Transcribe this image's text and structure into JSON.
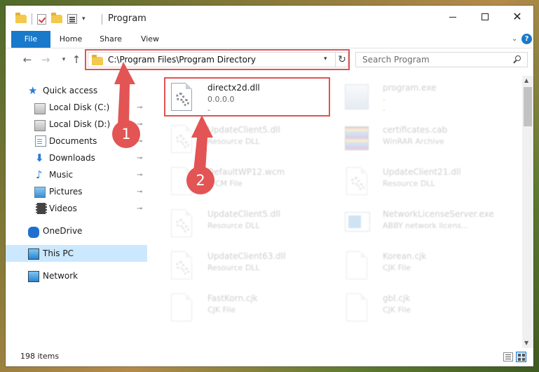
{
  "window": {
    "title": "Program",
    "controls": {
      "minimize": "—",
      "maximize": "☐",
      "close": "✕"
    }
  },
  "ribbon": {
    "tabs": [
      {
        "label": "File",
        "active": true
      },
      {
        "label": "Home"
      },
      {
        "label": "Share"
      },
      {
        "label": "View"
      }
    ],
    "help": "?"
  },
  "address": {
    "path": "C:\\Program Files\\Program Directory",
    "refresh_glyph": "↻",
    "dropdown_glyph": "⌄"
  },
  "search": {
    "placeholder": "Search Program"
  },
  "nav": {
    "back": "←",
    "forward": "→",
    "recent": "⌄",
    "up": "↑",
    "items": [
      {
        "label": "Quick access",
        "icon": "star-icon"
      },
      {
        "label": "Local Disk (C:)",
        "icon": "drive-icon",
        "pinned": true
      },
      {
        "label": "Local Disk (D:)",
        "icon": "drive-icon",
        "pinned": true
      },
      {
        "label": "Documents",
        "icon": "documents-icon",
        "pinned": true
      },
      {
        "label": "Downloads",
        "icon": "download-icon",
        "pinned": true
      },
      {
        "label": "Music",
        "icon": "music-icon",
        "pinned": true
      },
      {
        "label": "Pictures",
        "icon": "pictures-icon",
        "pinned": true
      },
      {
        "label": "Videos",
        "icon": "videos-icon",
        "pinned": true
      },
      {
        "label": "OneDrive",
        "icon": "onedrive-icon"
      },
      {
        "label": "This PC",
        "icon": "this-pc-icon",
        "selected": true
      },
      {
        "label": "Network",
        "icon": "network-icon"
      }
    ],
    "pin_glyph": "📌"
  },
  "files": [
    {
      "name": "directx2d.dll",
      "desc": "0.0.0.0",
      "sub": "-",
      "type": "dll",
      "highlighted": true
    },
    {
      "name": "program.exe",
      "desc": "-",
      "sub": "-",
      "type": "exe"
    },
    {
      "name": "UpdateClient5.dll",
      "desc": "Resource DLL",
      "type": "dll"
    },
    {
      "name": "certificates.cab",
      "desc": "WinRAR Archive",
      "type": "rar"
    },
    {
      "name": "DefaultWP12.wcm",
      "desc": "WCM File",
      "type": "doc"
    },
    {
      "name": "UpdateClient21.dll",
      "desc": "Resource DLL",
      "type": "dll"
    },
    {
      "name": "UpdateClient5.dll",
      "desc": "Resource DLL",
      "type": "dll"
    },
    {
      "name": "NetworkLicenseServer.exe",
      "desc": "ABBY network licens...",
      "type": "net"
    },
    {
      "name": "UpdateClient63.dll",
      "desc": "Resource DLL",
      "type": "dll"
    },
    {
      "name": "Korean.cjk",
      "desc": "CJK File",
      "type": "doc"
    },
    {
      "name": "FastKorn.cjk",
      "desc": "CJK File",
      "type": "doc"
    },
    {
      "name": "gbl.cjk",
      "desc": "CJK File",
      "type": "doc"
    }
  ],
  "annotations": {
    "step1": "1",
    "step2": "2"
  },
  "status": {
    "count": "198 items"
  },
  "colors": {
    "accent": "#1979ca",
    "highlight": "#e05353",
    "selected": "#cce8ff"
  }
}
